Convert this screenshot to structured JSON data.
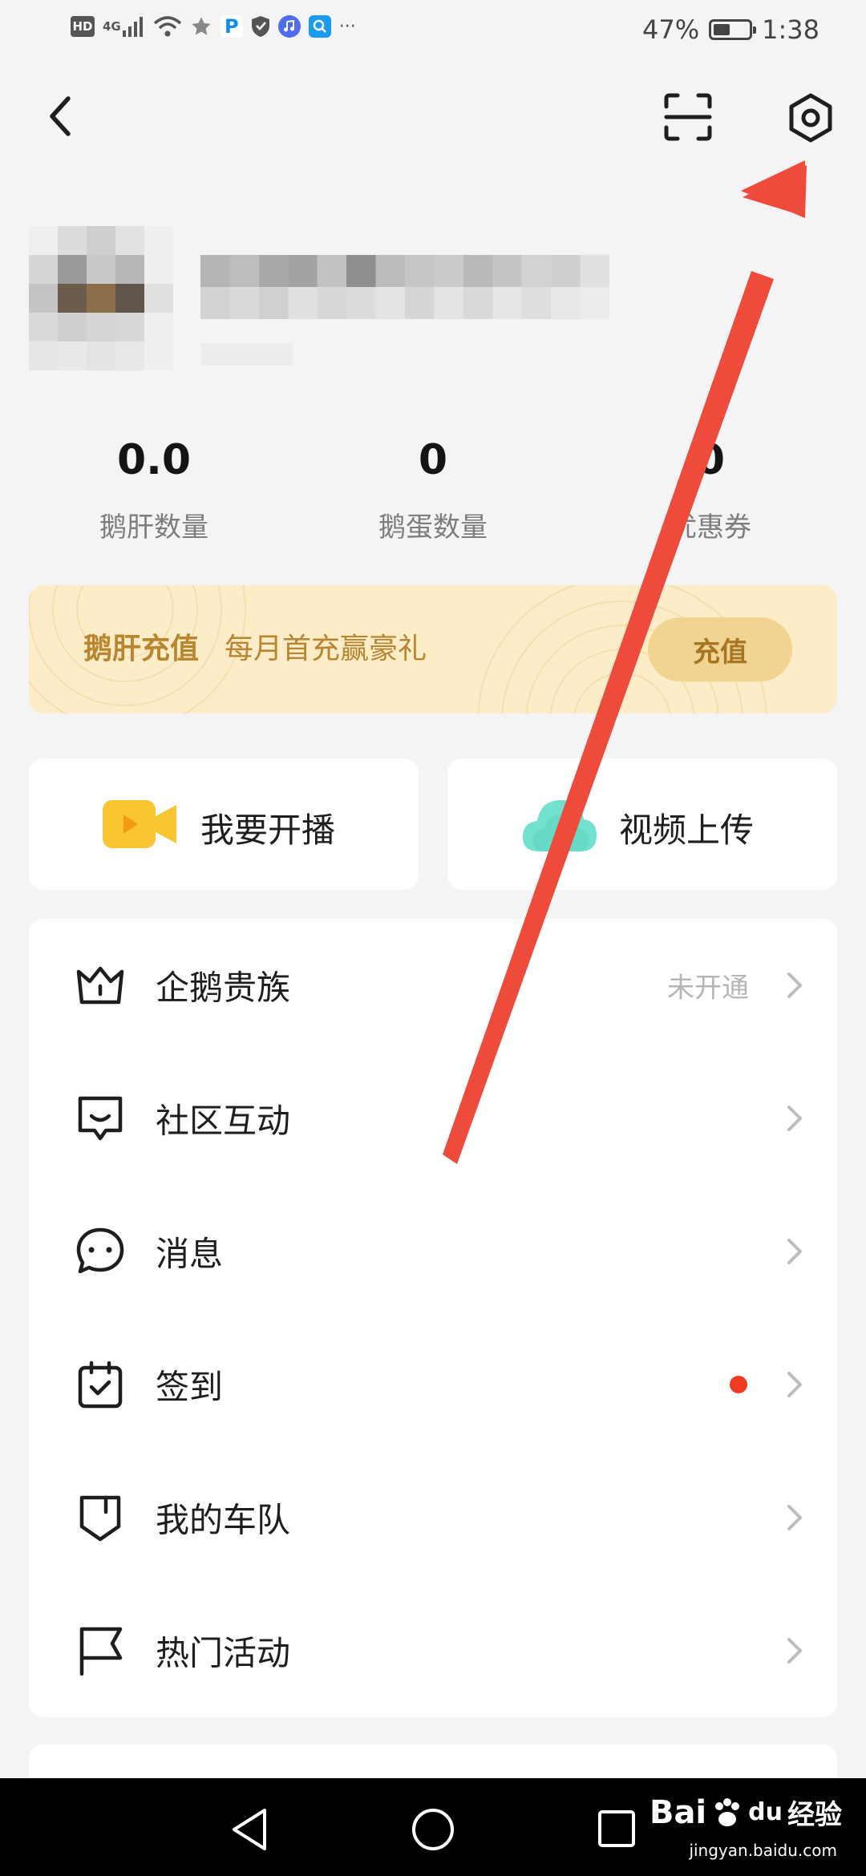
{
  "status_bar": {
    "hd": "HD",
    "net": "4G",
    "p_app": "P",
    "more": "···",
    "battery": "47%",
    "battery_fraction": 0.47,
    "time": "1:38"
  },
  "stats": [
    {
      "value": "0.0",
      "label": "鹅肝数量"
    },
    {
      "value": "0",
      "label": "鹅蛋数量"
    },
    {
      "value": "0",
      "label": "优惠券"
    }
  ],
  "banner": {
    "title": "鹅肝充值",
    "subtitle": "每月首充赢豪礼",
    "button": "充值"
  },
  "quick_actions": [
    {
      "label": "我要开播",
      "icon": "video-camera-icon"
    },
    {
      "label": "视频上传",
      "icon": "cloud-upload-icon"
    }
  ],
  "menu": [
    {
      "label": "企鹅贵族",
      "icon": "crown-icon",
      "status": "未开通"
    },
    {
      "label": "社区互动",
      "icon": "chat-smile-icon"
    },
    {
      "label": "消息",
      "icon": "message-bubble-icon"
    },
    {
      "label": "签到",
      "icon": "calendar-check-icon",
      "badge": "red-dot"
    },
    {
      "label": "我的车队",
      "icon": "shield-icon"
    },
    {
      "label": "热门活动",
      "icon": "flag-icon"
    }
  ],
  "watermark": {
    "brand_main": "Bai",
    "brand_paw": "du",
    "brand_cn": "经验",
    "url": "jingyan.baidu.com"
  },
  "colors": {
    "accent_gold": "#b88530",
    "banner_bg": "#fcecc7",
    "badge_red": "#f13a22",
    "annotation_arrow": "#ef4b3c"
  }
}
